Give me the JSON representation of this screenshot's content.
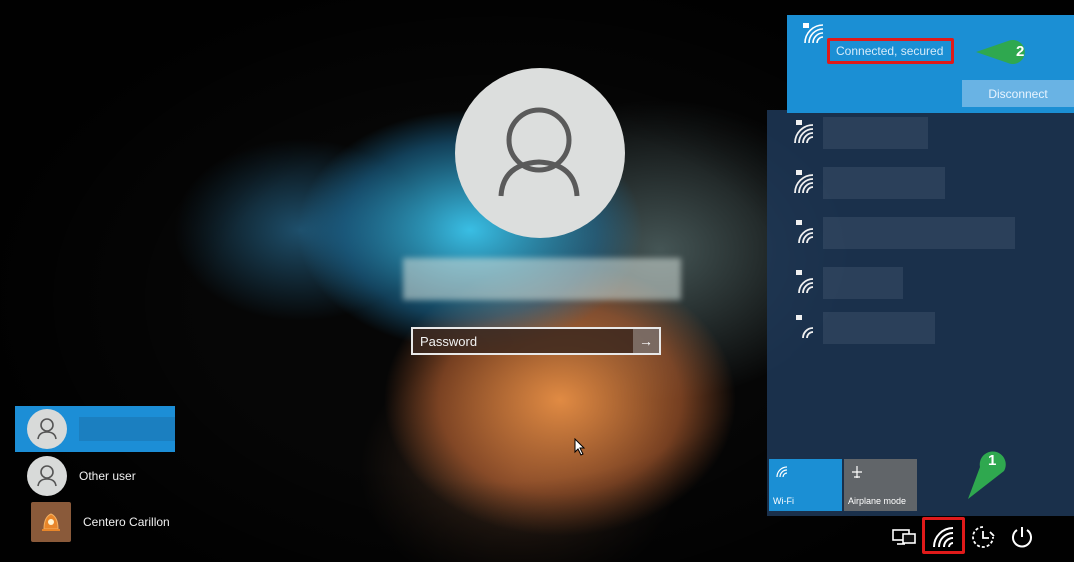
{
  "login": {
    "password_placeholder": "Password",
    "submit_glyph": "→"
  },
  "users": [
    {
      "name": "",
      "selected": true
    },
    {
      "name": "Other user",
      "selected": false
    },
    {
      "name": "Centero Carillon",
      "selected": false
    }
  ],
  "network_flyout": {
    "connected_status": "Connected, secured",
    "disconnect_label": "Disconnect",
    "networks_count_visible": 5,
    "quick_actions": [
      {
        "label": "Wi-Fi",
        "icon": "wifi-icon",
        "active": true
      },
      {
        "label": "Airplane mode",
        "icon": "airplane-icon",
        "active": false
      }
    ]
  },
  "tray": {
    "icons": [
      "display-icon",
      "wifi-icon",
      "ease-of-access-icon",
      "power-icon"
    ]
  },
  "callouts": [
    {
      "number": "1",
      "color": "#2fa84f"
    },
    {
      "number": "2",
      "color": "#2fa84f"
    }
  ],
  "colors": {
    "accent_blue": "#1b8fd4",
    "highlight_red": "#e01a1a",
    "callout_green": "#2fa84f"
  }
}
